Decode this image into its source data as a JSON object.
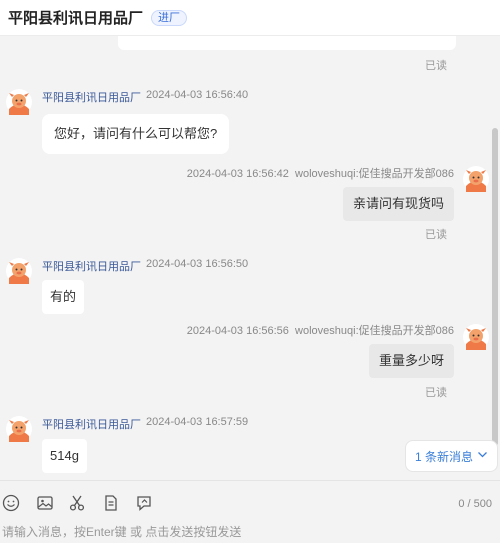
{
  "header": {
    "title": "平阳县利讯日用品厂",
    "tag": "进厂"
  },
  "shop_name": "平阳县利讯日用品厂",
  "agent_name": "woloveshuqi:促佳搜品开发部086",
  "read_label": "已读",
  "messages": [
    {
      "time": "2024-04-03 16:56:40",
      "text": "您好，请问有什么可以帮您?"
    },
    {
      "time": "2024-04-03 16:56:42",
      "text": "亲请问有现货吗"
    },
    {
      "time": "2024-04-03 16:56:50",
      "text": "有的"
    },
    {
      "time": "2024-04-03 16:56:56",
      "text": "重量多少呀"
    },
    {
      "time": "2024-04-03 16:57:59",
      "text": "514g"
    }
  ],
  "new_messages": {
    "label": "1 条新消息"
  },
  "toolbar": {
    "counter": "0 / 500"
  },
  "input": {
    "placeholder": "请输入消息，按Enter键 或 点击发送按钮发送"
  },
  "icons": [
    "emoji-icon",
    "image-icon",
    "scissors-icon",
    "document-icon",
    "share-icon",
    "chevron-down-icon"
  ],
  "colors": {
    "brand_blue": "#3b7fd8",
    "name_color": "#3b5998",
    "avatar_orange": "#f07a47"
  }
}
